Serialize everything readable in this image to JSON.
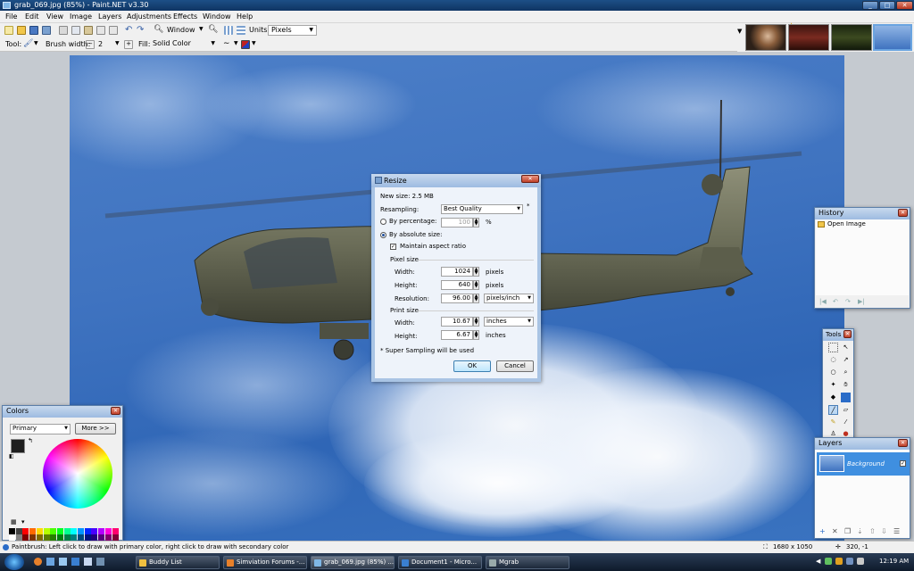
{
  "window": {
    "title": "grab_069.jpg (85%) - Paint.NET v3.30"
  },
  "menu": [
    "File",
    "Edit",
    "View",
    "Image",
    "Layers",
    "Adjustments",
    "Effects",
    "Window",
    "Help"
  ],
  "toolbar": {
    "zoom_label": "Window",
    "units_label": "Units:",
    "units_value": "Pixels",
    "tool_label": "Tool:",
    "brush_width_label": "Brush width:",
    "brush_width_value": "2",
    "fill_label": "Fill:",
    "fill_value": "Solid Color"
  },
  "resize": {
    "title": "Resize",
    "new_size": "New size: 2.5 MB",
    "resampling_label": "Resampling:",
    "resampling_value": "Best Quality",
    "by_percentage_label": "By percentage:",
    "percentage_value": "100",
    "percent_sign": "%",
    "by_absolute_label": "By absolute size:",
    "maintain_aspect": "Maintain aspect ratio",
    "pixel_size_heading": "Pixel size",
    "width_label": "Width:",
    "width_value": "1024",
    "width_unit": "pixels",
    "height_label": "Height:",
    "height_value": "640",
    "height_unit": "pixels",
    "resolution_label": "Resolution:",
    "resolution_value": "96.00",
    "resolution_unit": "pixels/inch",
    "print_size_heading": "Print size",
    "print_width_label": "Width:",
    "print_width_value": "10.67",
    "print_width_unit": "inches",
    "print_height_label": "Height:",
    "print_height_value": "6.67",
    "print_height_unit": "inches",
    "note": "* Super Sampling will be used",
    "ok": "OK",
    "cancel": "Cancel",
    "asterisk": "*"
  },
  "history": {
    "title": "History",
    "items": [
      "Open Image"
    ]
  },
  "tools": {
    "title": "Tools"
  },
  "layers": {
    "title": "Layers",
    "items": [
      "Background"
    ]
  },
  "colors": {
    "title": "Colors",
    "mode": "Primary",
    "more": "More >>",
    "primary": "#1e1e1e",
    "secondary": "#ffffff"
  },
  "status": {
    "hint": "Paintbrush: Left click to draw with primary color, right click to draw with secondary color",
    "image_size": "1680 x 1050",
    "cursor": "320, -1"
  },
  "taskbar": {
    "items": [
      "Buddy List",
      "Simviation Forums -...",
      "grab_069.jpg (85%) ...",
      "Document1 - Micro...",
      "Mgrab"
    ],
    "clock": "12:19 AM"
  },
  "palette": [
    "#000000",
    "#404040",
    "#ff0000",
    "#ff6a00",
    "#ffd800",
    "#b6ff00",
    "#4cff00",
    "#00ff21",
    "#00ff90",
    "#00ffff",
    "#0094ff",
    "#0026ff",
    "#4800ff",
    "#b200ff",
    "#ff00dc",
    "#ff006e",
    "#ffffff",
    "#808080",
    "#7f0000",
    "#7f3300",
    "#7f6a00",
    "#5b7f00",
    "#267f00",
    "#007f0e",
    "#007f46",
    "#007f7f",
    "#004a7f",
    "#00137f",
    "#21007f",
    "#57007f",
    "#7f006e",
    "#7f0037"
  ]
}
